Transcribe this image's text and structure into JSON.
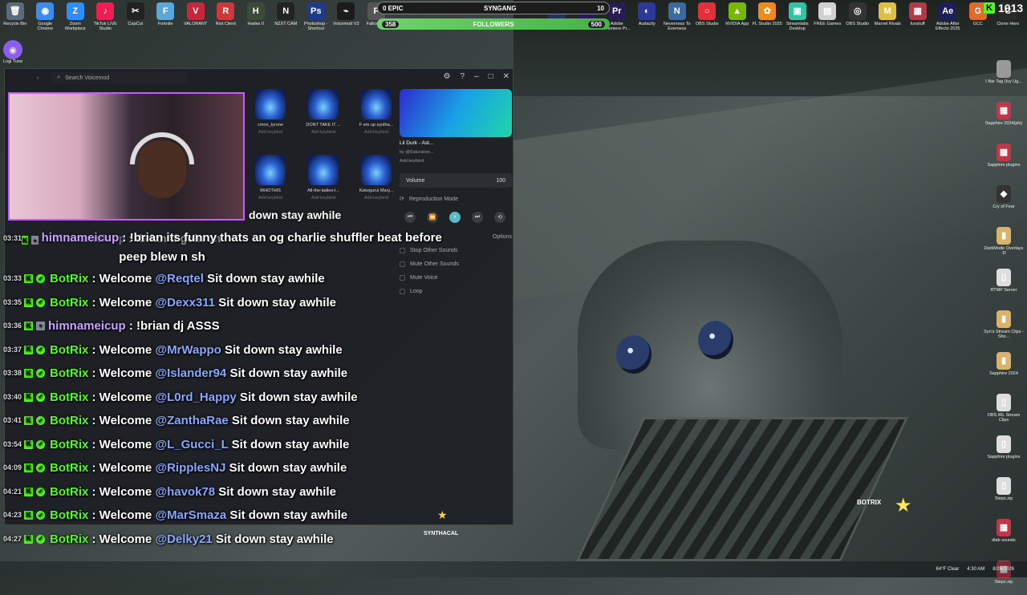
{
  "desktop_top_icons": [
    {
      "label": "Recycle Bin",
      "glyph": "🗑",
      "color": "#5a6a7a"
    },
    {
      "label": "Google Chrome",
      "glyph": "◉",
      "color": "#3c8cf0"
    },
    {
      "label": "Zoom Workplace",
      "glyph": "Z",
      "color": "#2d8cff"
    },
    {
      "label": "TikTok LIVE Studio",
      "glyph": "♪",
      "color": "#ee1d52"
    },
    {
      "label": "CapCut",
      "glyph": "✂",
      "color": "#222"
    },
    {
      "label": "Fortnite",
      "glyph": "F",
      "color": "#5aa7d8"
    },
    {
      "label": "VALORANT",
      "glyph": "V",
      "color": "#c9263b"
    },
    {
      "label": "Riot Client",
      "glyph": "R",
      "color": "#d13639"
    },
    {
      "label": "Hades II",
      "glyph": "H",
      "color": "#3c4a3a"
    },
    {
      "label": "NZXT CAM",
      "glyph": "N",
      "color": "#222"
    },
    {
      "label": "Photoshop - Shortcut",
      "glyph": "Ps",
      "color": "#1f3a8a"
    },
    {
      "label": "Voicemod V3",
      "glyph": "⌁",
      "color": "#1b1b1b"
    },
    {
      "label": "Fallout 76",
      "glyph": "F",
      "color": "#555"
    },
    {
      "label": "",
      "glyph": "",
      "color": "transparent"
    },
    {
      "label": "",
      "glyph": "",
      "color": "transparent"
    },
    {
      "label": "",
      "glyph": "",
      "color": "transparent"
    },
    {
      "label": "",
      "glyph": "",
      "color": "transparent"
    },
    {
      "label": "",
      "glyph": "",
      "color": "transparent"
    },
    {
      "label": "VEGAS Pro",
      "glyph": "V",
      "color": "#25335c"
    },
    {
      "label": "Adobe",
      "glyph": "Pr",
      "color": "#2a1a55"
    },
    {
      "label": "Adobe Premiere Pr...",
      "glyph": "Pr",
      "color": "#2a1a55"
    },
    {
      "label": "Audacity",
      "glyph": "◐",
      "color": "#2b3a9a"
    },
    {
      "label": "Neverness To Everness",
      "glyph": "N",
      "color": "#3b6aa0"
    },
    {
      "label": "OBS Studio",
      "glyph": "○",
      "color": "#e0303a"
    },
    {
      "label": "NVIDIA App",
      "glyph": "▲",
      "color": "#76b900"
    },
    {
      "label": "FL Studio 2025",
      "glyph": "✿",
      "color": "#f28a1a"
    },
    {
      "label": "Streamlabs Desktop",
      "glyph": "▣",
      "color": "#31c3a2"
    },
    {
      "label": "FREE Games",
      "glyph": "▤",
      "color": "#d0d0d0"
    },
    {
      "label": "OBS Studio",
      "glyph": "◎",
      "color": "#333"
    },
    {
      "label": "Marvel Rivals",
      "glyph": "M",
      "color": "#e0c040"
    },
    {
      "label": "funstuff",
      "glyph": "▦",
      "color": "#b03a48"
    },
    {
      "label": "Adobe After Effects 2025",
      "glyph": "Ae",
      "color": "#1d1f5a"
    },
    {
      "label": "GCC",
      "glyph": "G",
      "color": "#e06a2a"
    },
    {
      "label": "Clone Hero",
      "glyph": "C",
      "color": "#2a2a2a"
    }
  ],
  "right_icons": [
    {
      "label": "I Bar Tag (Ivy Ug...",
      "glyph": "",
      "color": "#999"
    },
    {
      "label": "Sapphire 2024(pls)",
      "glyph": "▦",
      "color": "#c03848"
    },
    {
      "label": "Sapphire plugins",
      "glyph": "▦",
      "color": "#c03848"
    },
    {
      "label": "Cry of Fear",
      "glyph": "◆",
      "color": "#333"
    },
    {
      "label": "DarkMode Overlays :D",
      "glyph": "▮",
      "color": "#d9b36a"
    },
    {
      "label": "RTMP Server",
      "glyph": "▯",
      "color": "#ddd"
    },
    {
      "label": "Syn's Stream Clips - Sho...",
      "glyph": "▮",
      "color": "#d9b36a"
    },
    {
      "label": "Sapphire 2024",
      "glyph": "▮",
      "color": "#d9b36a"
    },
    {
      "label": "OBS IRL Stream Clips",
      "glyph": "▯",
      "color": "#ddd"
    },
    {
      "label": "Sapphire plugins",
      "glyph": "▯",
      "color": "#ddd"
    },
    {
      "label": "Stepz.zip",
      "glyph": "▯",
      "color": "#ddd"
    },
    {
      "label": "dlab sounds",
      "glyph": "▦",
      "color": "#c03848"
    },
    {
      "label": "Stepz.zip",
      "glyph": "▦",
      "color": "#c03848"
    }
  ],
  "logi": {
    "label": "Logi Tune"
  },
  "followers_widget": {
    "left": "0 EPIC",
    "center": "SYNGANG",
    "right": "10",
    "current": "358",
    "label": "FOLLOWERS",
    "goal": "500"
  },
  "kick_stat": {
    "icon": "K",
    "count": "1013"
  },
  "voicemod": {
    "search_placeholder": "Search Voicemod",
    "tiles": [
      {
        "name": "cmon_tyrone",
        "keybind": "Add keybind"
      },
      {
        "name": "DONT TAKE IT ...",
        "keybind": "Add keybind"
      },
      {
        "name": "F em up syntha...",
        "keybind": "Add keybind"
      },
      {
        "name": "WHOTHIS",
        "keybind": "Add keybind"
      },
      {
        "name": "All-the-ladies-l...",
        "keybind": "Add keybind"
      },
      {
        "name": "Kakegurui Mary...",
        "keybind": "Add keybind"
      }
    ],
    "now_playing": {
      "title": "Lil Durk - Ast...",
      "artist": "by @Saturation...",
      "keybind": "Add keybind"
    },
    "volume": {
      "label": "Volume",
      "value": "100"
    },
    "reproduction_mode": "Reproduction Mode",
    "options_label": "Options",
    "options": [
      "Stop Other Sounds",
      "Mute Other Sounds",
      "Mute Voice",
      "Loop"
    ]
  },
  "chat": [
    {
      "ts": "03:31",
      "user": "himnameicup",
      "type": "h",
      "pre": ": !brian its funny thats an og charlie shuffler beat before peep blew n sh",
      "mention": "",
      "post": ""
    },
    {
      "ts": "03:33",
      "user": "BotRix",
      "type": "bot",
      "pre": ": Welcome ",
      "mention": "@Reqtel",
      "post": " Sit down stay awhile"
    },
    {
      "ts": "03:35",
      "user": "BotRix",
      "type": "bot",
      "pre": ": Welcome ",
      "mention": "@Dexx311",
      "post": " Sit down stay awhile"
    },
    {
      "ts": "03:36",
      "user": "himnameicup",
      "type": "h",
      "pre": ": !brian dj ASSS",
      "mention": "",
      "post": ""
    },
    {
      "ts": "03:37",
      "user": "BotRix",
      "type": "bot",
      "pre": ": Welcome ",
      "mention": "@MrWappo",
      "post": " Sit down stay awhile"
    },
    {
      "ts": "03:38",
      "user": "BotRix",
      "type": "bot",
      "pre": ": Welcome ",
      "mention": "@Islander94",
      "post": " Sit down stay awhile"
    },
    {
      "ts": "03:40",
      "user": "BotRix",
      "type": "bot",
      "pre": ": Welcome ",
      "mention": "@L0rd_Happy",
      "post": " Sit down stay awhile"
    },
    {
      "ts": "03:41",
      "user": "BotRix",
      "type": "bot",
      "pre": ": Welcome ",
      "mention": "@ZanthaRae",
      "post": " Sit down stay awhile"
    },
    {
      "ts": "03:54",
      "user": "BotRix",
      "type": "bot",
      "pre": ": Welcome ",
      "mention": "@L_Gucci_L",
      "post": " Sit down stay awhile"
    },
    {
      "ts": "04:09",
      "user": "BotRix",
      "type": "bot",
      "pre": ": Welcome ",
      "mention": "@RipplesNJ",
      "post": " Sit down stay awhile"
    },
    {
      "ts": "04:21",
      "user": "BotRix",
      "type": "bot",
      "pre": ": Welcome ",
      "mention": "@havok78",
      "post": " Sit down stay awhile"
    },
    {
      "ts": "04:23",
      "user": "BotRix",
      "type": "bot",
      "pre": ": Welcome ",
      "mention": "@MarSmaza",
      "post": " Sit down stay awhile"
    },
    {
      "ts": "04:27",
      "user": "BotRix",
      "type": "bot",
      "pre": ": Welcome ",
      "mention": "@Delky21",
      "post": " Sit down stay awhile"
    }
  ],
  "chat_top_partial": {
    "text": "down stay awhile",
    "ghost_user": "himnameicup",
    "ghost_text": ": !brian tf goin on"
  },
  "overlay": {
    "botrix": "BOTRIX",
    "synth": "SYNTHACAL"
  },
  "taskbar": {
    "weather": "64°F Clear",
    "time": "4:30 AM",
    "date": "8/26/2026"
  }
}
